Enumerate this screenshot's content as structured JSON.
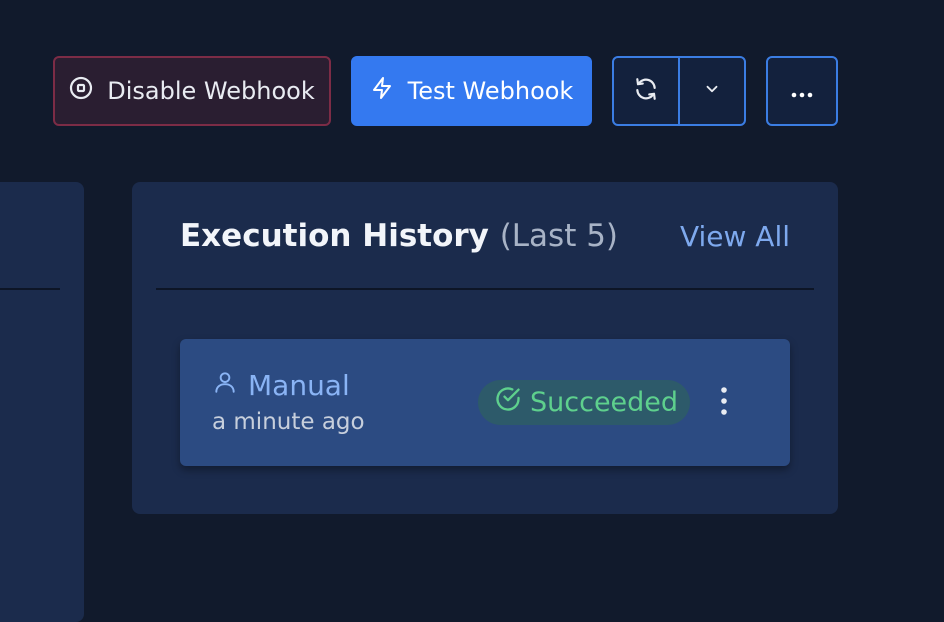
{
  "toolbar": {
    "disable_label": "Disable Webhook",
    "test_label": "Test Webhook"
  },
  "history": {
    "title": "Execution History",
    "title_suffix": "(Last 5)",
    "view_all": "View All",
    "items": [
      {
        "type": "Manual",
        "time": "a minute ago",
        "status": "Succeeded"
      }
    ]
  },
  "colors": {
    "background": "#111a2c",
    "panel": "#1b2b4c",
    "card": "#2c4b82",
    "primary": "#3479f0",
    "danger_border": "#7c2c46",
    "success": "#5ed08d",
    "link": "#7ea9ee"
  },
  "icons": {
    "disable": "stop-circle-icon",
    "test": "lightning-icon",
    "refresh": "refresh-icon",
    "dropdown": "chevron-down-icon",
    "more": "ellipsis-horizontal-icon",
    "trigger_type": "user-icon",
    "status": "check-circle-icon",
    "item_menu": "ellipsis-vertical-icon"
  }
}
